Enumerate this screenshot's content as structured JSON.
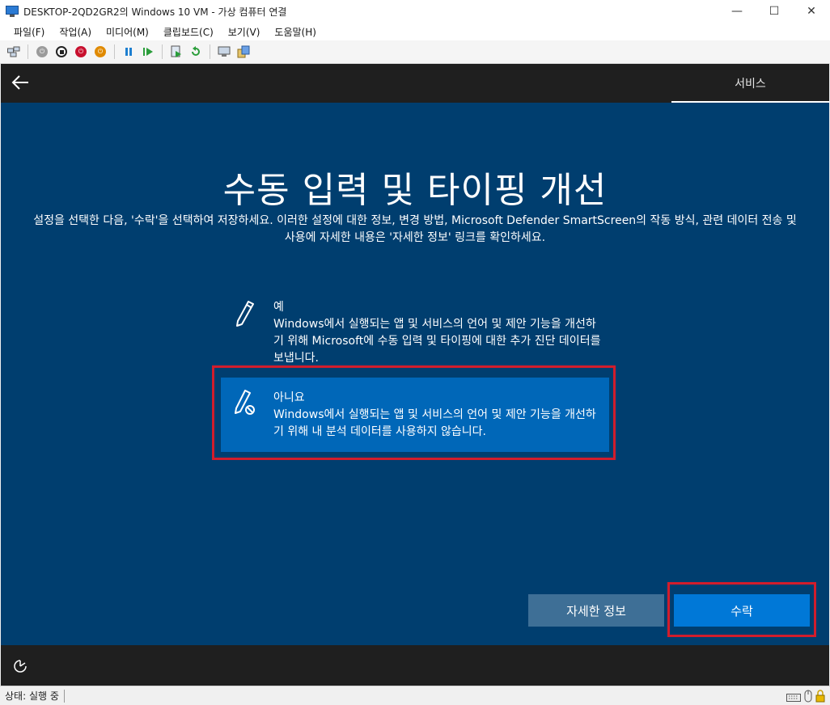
{
  "window": {
    "title": "DESKTOP-2QD2GR2의 Windows 10 VM - 가상 컴퓨터 연결",
    "minimize": "—",
    "maximize": "☐",
    "close": "✕"
  },
  "menu": [
    "파일(F)",
    "작업(A)",
    "미디어(M)",
    "클립보드(C)",
    "보기(V)",
    "도움말(H)"
  ],
  "toolbar_icons": [
    "ctrl-alt-del-icon",
    "start-icon",
    "turn-off-icon",
    "shutdown-icon",
    "save-icon",
    "pause-icon",
    "resume-icon",
    "checkpoint-icon",
    "revert-icon",
    "enhanced-session-icon",
    "share-icon"
  ],
  "vm": {
    "tab_label": "서비스",
    "heading": "수동 입력 및 타이핑 개선",
    "description": "설정을 선택한 다음, '수락'을 선택하여 저장하세요. 이러한 설정에 대한 정보, 변경 방법, Microsoft Defender SmartScreen의 작동 방식, 관련 데이터 전송 및 사용에 자세한 내용은 '자세한 정보' 링크를 확인하세요.",
    "options": [
      {
        "title": "예",
        "body": "Windows에서 실행되는 앱 및 서비스의 언어 및 제안 기능을 개선하기 위해 Microsoft에 수동 입력 및 타이핑에 대한 추가 진단 데이터를 보냅니다.",
        "selected": false,
        "icon": "pen-icon"
      },
      {
        "title": "아니요",
        "body": "Windows에서 실행되는 앱 및 서비스의 언어 및 제안 기능을 개선하기 위해 내 분석 데이터를 사용하지 않습니다.",
        "selected": true,
        "icon": "pen-disabled-icon"
      }
    ],
    "buttons": {
      "more_info": "자세한 정보",
      "accept": "수락"
    }
  },
  "status": {
    "text": "상태: 실행 중"
  },
  "colors": {
    "vm_background": "#003e6f",
    "selected_option": "#0067b8",
    "accept_button": "#0078d7",
    "highlight": "#d21d2c"
  }
}
